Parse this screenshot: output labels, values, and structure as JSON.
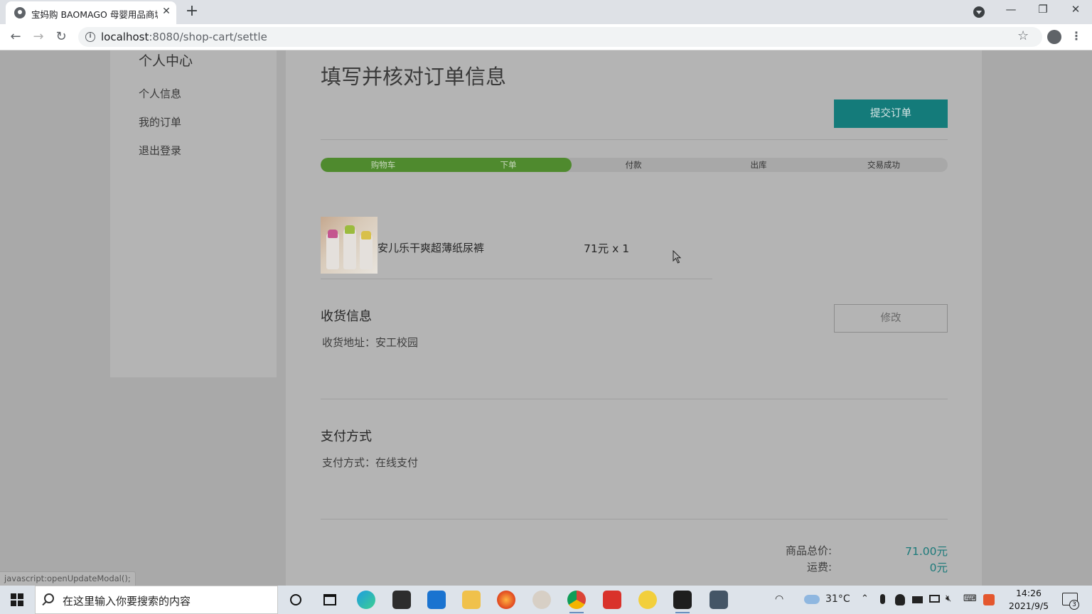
{
  "browser": {
    "tab_title": "宝妈购 BAOMAGO 母婴用品商城",
    "tab_close": "✕",
    "new_tab": "+",
    "url_host": "localhost",
    "url_path": ":8080/shop-cart/settle",
    "window_controls": [
      "—",
      "❐",
      "✕"
    ]
  },
  "sidebar": {
    "title": "个人中心",
    "items": [
      {
        "label": "个人信息"
      },
      {
        "label": "我的订单"
      },
      {
        "label": "退出登录"
      }
    ]
  },
  "main": {
    "title": "填写并核对订单信息",
    "submit_label": "提交订单",
    "progress": {
      "fill_fraction": 0.4,
      "steps": [
        {
          "label": "购物车",
          "done": true
        },
        {
          "label": "下单",
          "done": true
        },
        {
          "label": "付款",
          "done": false
        },
        {
          "label": "出库",
          "done": false
        },
        {
          "label": "交易成功",
          "done": false
        }
      ]
    },
    "product": {
      "name": "安儿乐干爽超薄纸尿裤",
      "qty": "71元 x 1"
    },
    "shipping": {
      "title": "收货信息",
      "address": "收货地址：安工校园",
      "modify_label": "修改"
    },
    "payment": {
      "title": "支付方式",
      "method": "支付方式：在线支付"
    },
    "totals": {
      "goods_label": "商品总价:",
      "goods_value": "71.00元",
      "shipping_label": "运费:",
      "shipping_value": "0元"
    }
  },
  "statusbar": {
    "text": "javascript:openUpdateModal();"
  },
  "taskbar": {
    "search_placeholder": "在这里输入你要搜索的内容",
    "temperature": "31°C",
    "time": "14:26",
    "date": "2021/9/5",
    "notifications": "3"
  },
  "colors": {
    "accent": "#147b7a",
    "progress_done": "#4f8a2e"
  }
}
